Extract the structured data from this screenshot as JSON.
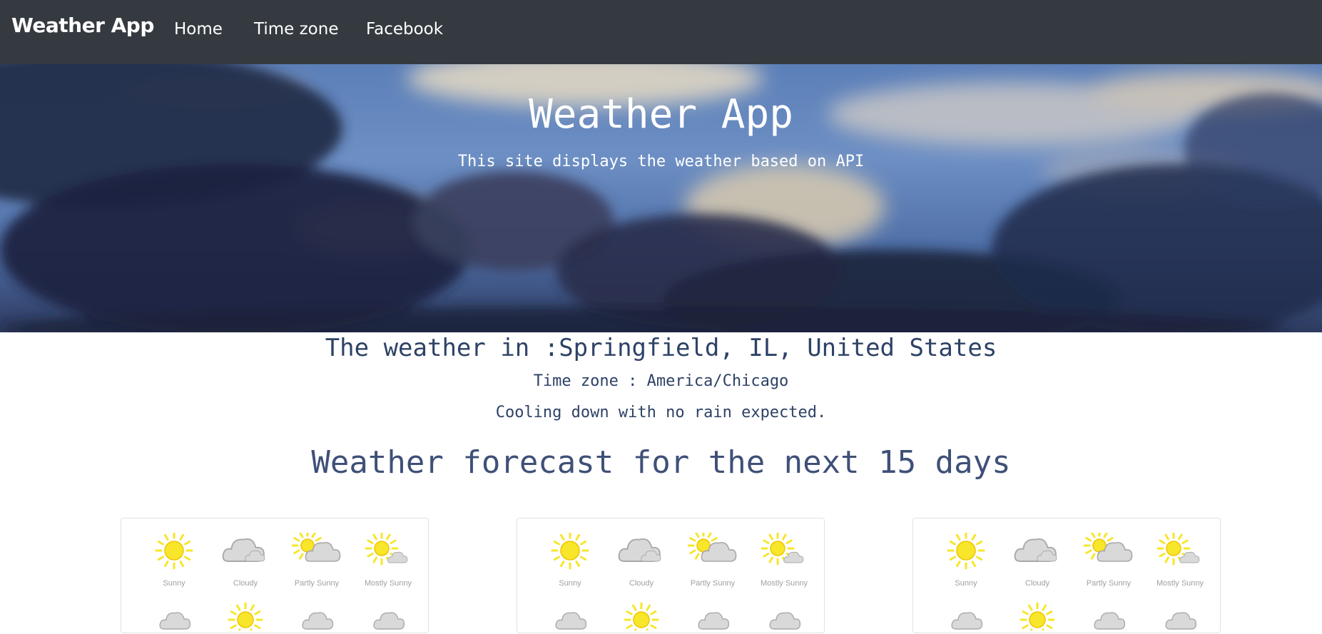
{
  "navbar": {
    "brand": "Weather App",
    "links": [
      "Home",
      "Time zone",
      "Facebook"
    ]
  },
  "hero": {
    "title": "Weather App",
    "subtitle": "This site displays the weather based on API"
  },
  "weather": {
    "location_line": "The weather in :Springfield, IL, United States",
    "timezone_line": "Time zone : America/Chicago",
    "description": "Cooling down with no rain expected."
  },
  "forecast": {
    "title": "Weather forecast for the next 15 days",
    "icon_labels": [
      "Sunny",
      "Cloudy",
      "Partly Sunny",
      "Mostly Sunny"
    ]
  },
  "colors": {
    "navbar": "#343a40",
    "text_primary": "#2e4266",
    "sun": "#f7e62a",
    "cloud": "#d9d9d9"
  }
}
